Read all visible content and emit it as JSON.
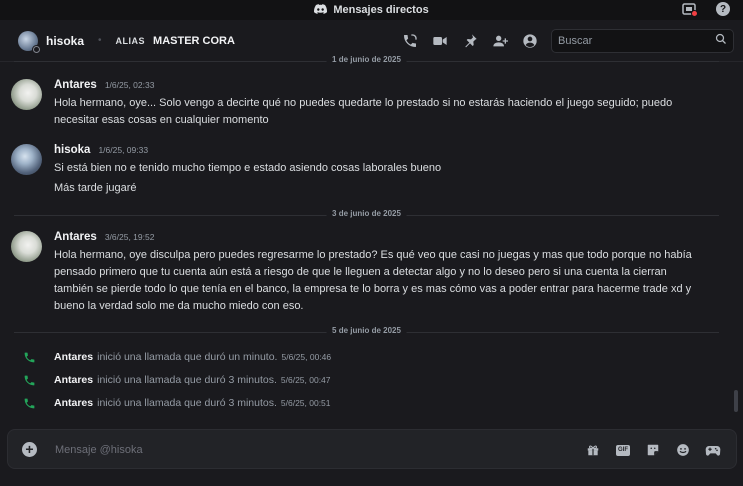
{
  "window": {
    "title": "Mensajes directos"
  },
  "header": {
    "username": "hisoka",
    "alias_label": "ALIAS",
    "nickname": "MASTER CORA",
    "search_placeholder": "Buscar"
  },
  "date_dividers": [
    "1 de junio de 2025",
    "3 de junio de 2025",
    "5 de junio de 2025"
  ],
  "messages": [
    {
      "author": "Antares",
      "time": "1/6/25, 02:33",
      "lines": [
        "Hola hermano, oye... Solo vengo a decirte qué no puedes quedarte lo prestado si no estarás haciendo el juego seguido; puedo",
        "necesitar esas cosas en cualquier momento"
      ]
    },
    {
      "author": "hisoka",
      "time": "1/6/25, 09:33",
      "lines": [
        "Si está bien no e tenido mucho tiempo e estado asiendo cosas laborales bueno"
      ],
      "followup": "Más tarde jugaré"
    },
    {
      "author": "Antares",
      "time": "3/6/25, 19:52",
      "lines": [
        "Hola hermano, oye disculpa pero puedes regresarme lo prestado? Es qué veo que casi no juegas y mas que todo porque no había",
        "pensado primero que tu cuenta aún está a riesgo de que le lleguen a detectar algo y no lo deseo pero si una cuenta la cierran",
        "también se pierde todo lo que tenía en el banco, la empresa te lo borra y es mas cómo vas a poder entrar para hacerme trade xd y",
        "bueno la verdad solo me da mucho miedo con eso."
      ]
    }
  ],
  "calls": [
    {
      "author": "Antares",
      "text": "inició una llamada que duró un minuto.",
      "time": "5/6/25, 00:46"
    },
    {
      "author": "Antares",
      "text": "inició una llamada que duró 3 minutos.",
      "time": "5/6/25, 00:47"
    },
    {
      "author": "Antares",
      "text": "inició una llamada que duró 3 minutos.",
      "time": "5/6/25, 00:51"
    }
  ],
  "composer": {
    "placeholder": "Mensaje @hisoka"
  },
  "colors": {
    "call_green": "#23a55a",
    "status_red": "#f23f43",
    "background": "#1a1a1e"
  }
}
